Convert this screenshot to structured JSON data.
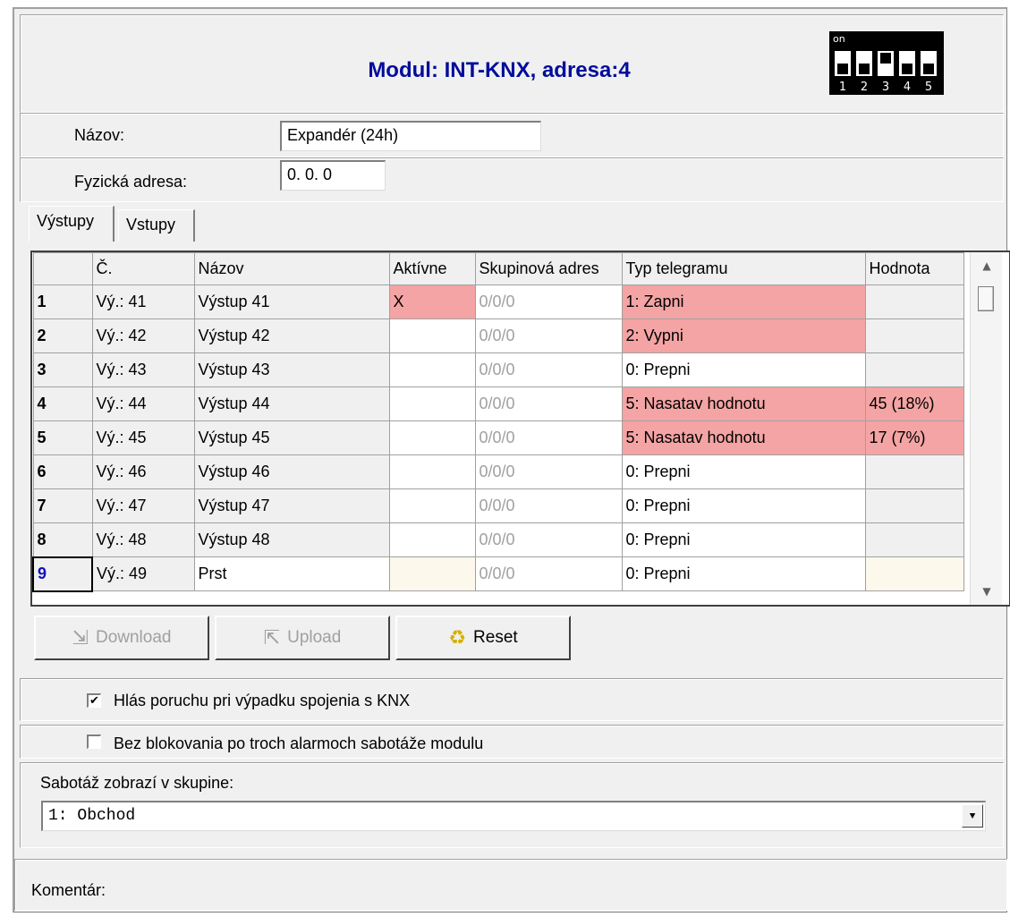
{
  "header": {
    "title": "Modul: INT-KNX, adresa:4",
    "dip": {
      "on_label": "on",
      "switches": [
        "1",
        "2",
        "3",
        "4",
        "5"
      ]
    }
  },
  "form": {
    "name_label": "Názov:",
    "name_value": "Expandér (24h)",
    "phys_label": "Fyzická adresa:",
    "phys_value": "0. 0.  0"
  },
  "tabs": [
    "Výstupy",
    "Vstupy"
  ],
  "grid": {
    "columns": [
      "",
      "Č.",
      "Názov",
      "Aktívne",
      "Skupinová adres",
      "Typ telegramu",
      "Hodnota"
    ],
    "rows": [
      {
        "idx": "1",
        "c": "Vý.: 41",
        "name": "Výstup  41",
        "active": "X",
        "addr": "0/0/0",
        "type": "1: Zapni",
        "value": ""
      },
      {
        "idx": "2",
        "c": "Vý.: 42",
        "name": "Výstup  42",
        "active": "",
        "addr": "0/0/0",
        "type": "2: Vypni",
        "value": ""
      },
      {
        "idx": "3",
        "c": "Vý.: 43",
        "name": "Výstup  43",
        "active": "",
        "addr": "0/0/0",
        "type": "0: Prepni",
        "value": ""
      },
      {
        "idx": "4",
        "c": "Vý.: 44",
        "name": "Výstup  44",
        "active": "",
        "addr": "0/0/0",
        "type": "5: Nasatav hodnotu",
        "value": "45 (18%)"
      },
      {
        "idx": "5",
        "c": "Vý.: 45",
        "name": "Výstup  45",
        "active": "",
        "addr": "0/0/0",
        "type": "5: Nasatav hodnotu",
        "value": "17 (7%)"
      },
      {
        "idx": "6",
        "c": "Vý.: 46",
        "name": "Výstup  46",
        "active": "",
        "addr": "0/0/0",
        "type": "0: Prepni",
        "value": ""
      },
      {
        "idx": "7",
        "c": "Vý.: 47",
        "name": "Výstup  47",
        "active": "",
        "addr": "0/0/0",
        "type": "0: Prepni",
        "value": ""
      },
      {
        "idx": "8",
        "c": "Vý.: 48",
        "name": "Výstup  48",
        "active": "",
        "addr": "0/0/0",
        "type": "0: Prepni",
        "value": ""
      },
      {
        "idx": "9",
        "c": "Vý.: 49",
        "name": "Prst",
        "active": "",
        "addr": "0/0/0",
        "type": "0: Prepni",
        "value": ""
      }
    ]
  },
  "buttons": {
    "download": "Download",
    "upload": "Upload",
    "reset": "Reset"
  },
  "options": {
    "knx_fault": "Hlás poruchu pri výpadku spojenia s KNX",
    "knx_fault_checked": "✔",
    "no_block": "Bez blokovania po troch alarmoch sabotáže modulu"
  },
  "tamper": {
    "label": "Sabotáž zobrazí v skupine:",
    "value": "1: Obchod"
  },
  "comment": {
    "label": "Komentár:"
  },
  "colors": {
    "title": "#000c9c",
    "highlight": "#f4a4a4",
    "selected_row": "#1010c0"
  }
}
